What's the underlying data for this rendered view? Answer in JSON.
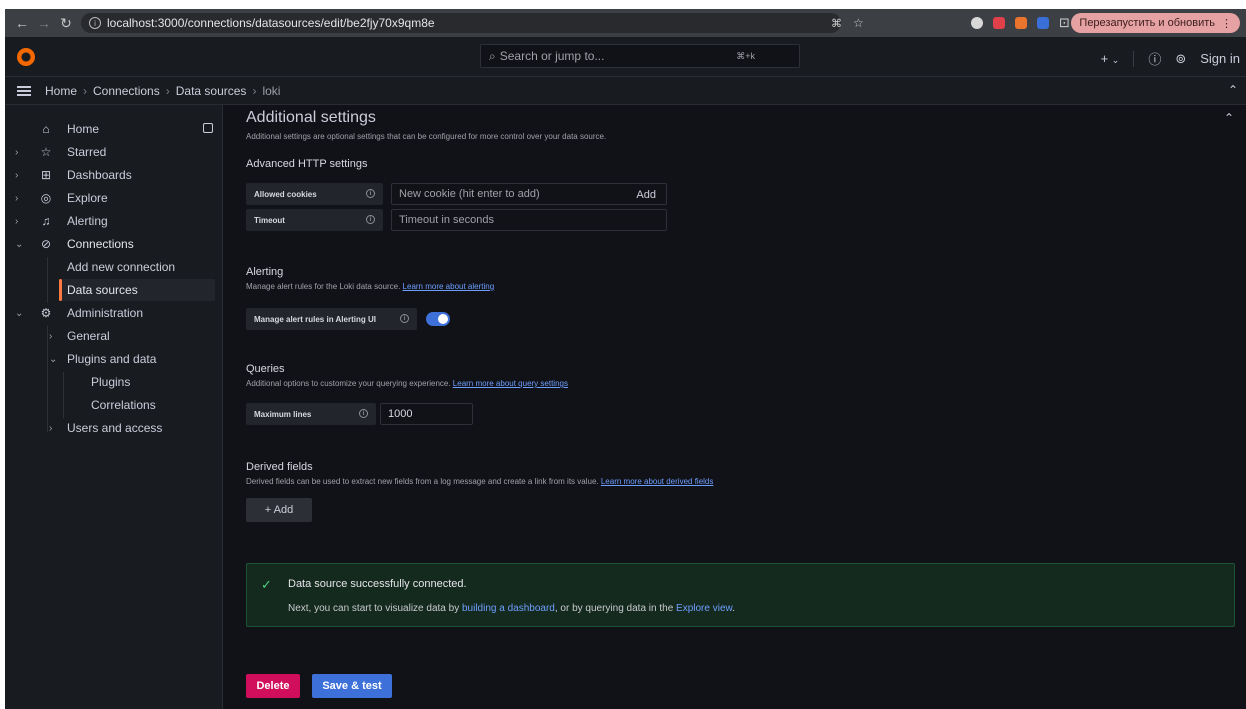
{
  "browser": {
    "url": "localhost:3000/connections/datasources/edit/be2fjy70x9qm8e",
    "relaunch_label": "Перезапустить и обновить"
  },
  "topbar": {
    "search_placeholder": "Search or jump to...",
    "search_shortcut": "⌘+k",
    "plus_label": "+",
    "sign_in_label": "Sign in"
  },
  "breadcrumbs": [
    "Home",
    "Connections",
    "Data sources",
    "loki"
  ],
  "sidebar": {
    "items": [
      {
        "label": "Home"
      },
      {
        "label": "Starred"
      },
      {
        "label": "Dashboards"
      },
      {
        "label": "Explore"
      },
      {
        "label": "Alerting"
      },
      {
        "label": "Connections"
      },
      {
        "label": "Add new connection"
      },
      {
        "label": "Data sources"
      },
      {
        "label": "Administration"
      },
      {
        "label": "General"
      },
      {
        "label": "Plugins and data"
      },
      {
        "label": "Plugins"
      },
      {
        "label": "Correlations"
      },
      {
        "label": "Users and access"
      }
    ]
  },
  "content": {
    "title": "Additional settings",
    "description": "Additional settings are optional settings that can be configured for more control over your data source.",
    "http": {
      "title": "Advanced HTTP settings",
      "cookies_label": "Allowed cookies",
      "cookies_placeholder": "New cookie (hit enter to add)",
      "cookies_add": "Add",
      "timeout_label": "Timeout",
      "timeout_placeholder": "Timeout in seconds"
    },
    "alerting": {
      "title": "Alerting",
      "description": "Manage alert rules for the Loki data source.",
      "link": "Learn more about alerting",
      "toggle_label": "Manage alert rules in Alerting UI",
      "toggle_on": true
    },
    "queries": {
      "title": "Queries",
      "description": "Additional options to customize your querying experience.",
      "link": "Learn more about query settings",
      "max_lines_label": "Maximum lines",
      "max_lines_value": "1000"
    },
    "derived": {
      "title": "Derived fields",
      "description": "Derived fields can be used to extract new fields from a log message and create a link from its value.",
      "link": "Learn more about derived fields",
      "add_label": "+ Add"
    },
    "alert": {
      "title": "Data source successfully connected.",
      "body_pre": "Next, you can start to visualize data by",
      "body_link1": "building a dashboard",
      "body_mid": ", or by querying data in the",
      "body_link2": "Explore view",
      "body_post": "."
    },
    "buttons": {
      "delete": "Delete",
      "save": "Save & test"
    }
  },
  "colors": {
    "accent": "#3d71d9",
    "danger": "#d10e5c",
    "active": "#ff7941",
    "success": "#4ed37e"
  }
}
